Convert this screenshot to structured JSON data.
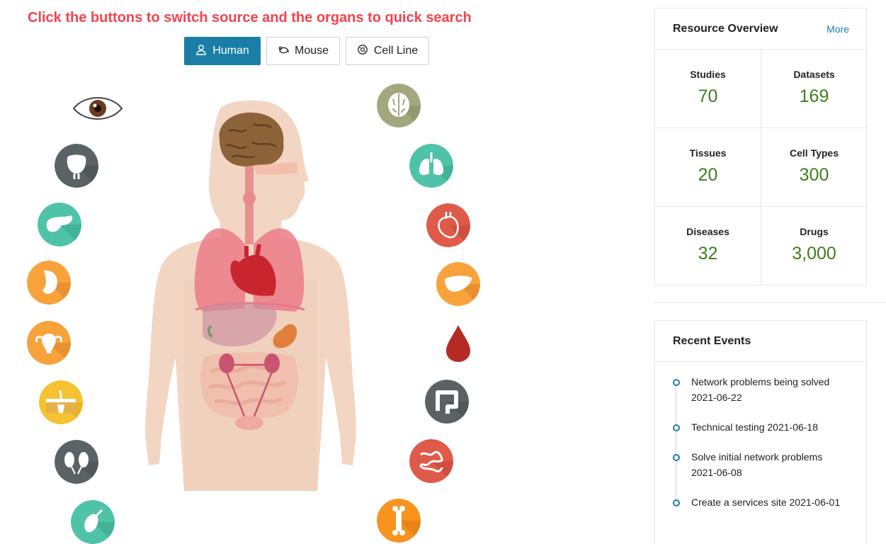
{
  "headline": "Click the buttons to switch source and the organs to quick search",
  "sources": [
    {
      "label": "Human",
      "icon": "person-icon",
      "active": true
    },
    {
      "label": "Mouse",
      "icon": "mouse-icon",
      "active": false
    },
    {
      "label": "Cell Line",
      "icon": "cell-icon",
      "active": false
    }
  ],
  "organs_left": [
    "eye",
    "bladder",
    "pancreas",
    "kidney-section",
    "uterus",
    "skin",
    "kidneys",
    "gallbladder"
  ],
  "organs_right": [
    "brain",
    "lungs",
    "heart",
    "liver",
    "blood",
    "large-intestine",
    "small-intestine",
    "bone"
  ],
  "overview": {
    "title": "Resource Overview",
    "more": "More",
    "stats": [
      {
        "label": "Studies",
        "value": "70"
      },
      {
        "label": "Datasets",
        "value": "169"
      },
      {
        "label": "Tissues",
        "value": "20"
      },
      {
        "label": "Cell Types",
        "value": "300"
      },
      {
        "label": "Diseases",
        "value": "32"
      },
      {
        "label": "Drugs",
        "value": "3,000"
      }
    ]
  },
  "events": {
    "title": "Recent Events",
    "items": [
      {
        "text": "Network problems being solved 2021-06-22"
      },
      {
        "text": "Technical testing 2021-06-18"
      },
      {
        "text": "Solve initial network problems 2021-06-08"
      },
      {
        "text": "Create a services site 2021-06-01"
      }
    ]
  },
  "colors": {
    "headline": "#f2444d",
    "accent": "#1a7ea6",
    "stat_value": "#3f7d1a"
  }
}
